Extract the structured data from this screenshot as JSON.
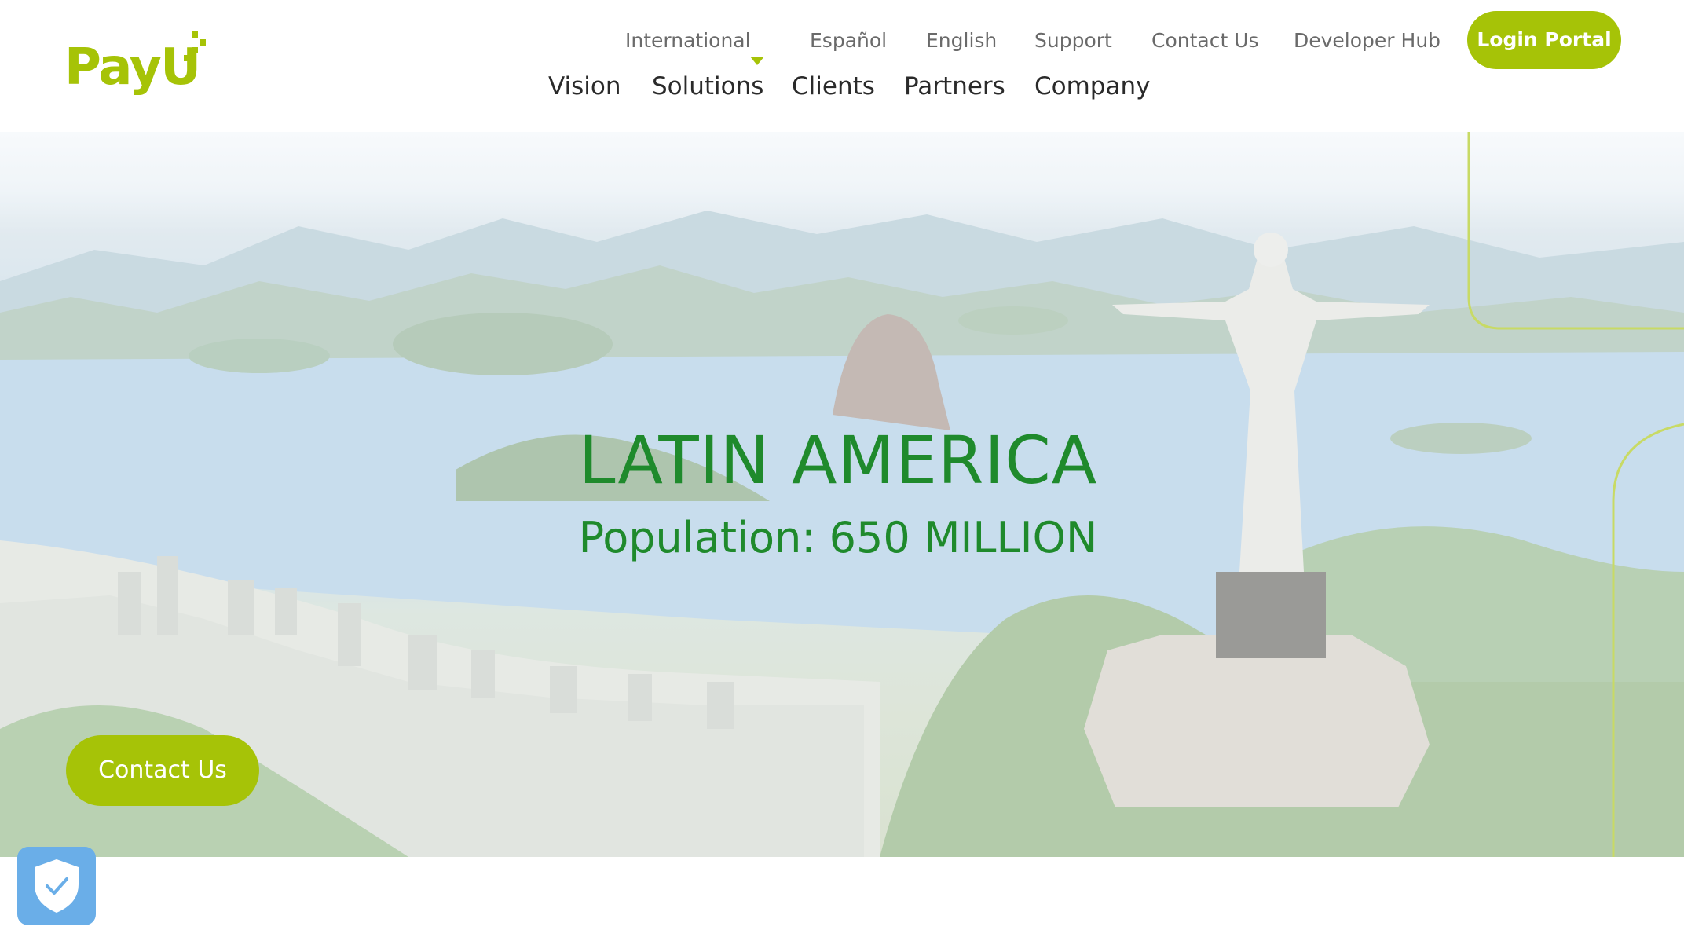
{
  "brand": {
    "logo_text": "PayU",
    "accent_color": "#a6c307",
    "headline_color": "#1f8a2c"
  },
  "utility_nav": {
    "region": "International",
    "region_icon": "caret-down-icon",
    "items": [
      "Español",
      "English",
      "Support",
      "Contact Us",
      "Developer Hub"
    ],
    "login_label": "Login Portal"
  },
  "main_nav": {
    "items": [
      "Vision",
      "Solutions",
      "Clients",
      "Partners",
      "Company"
    ]
  },
  "hero": {
    "background": "aerial view of Rio de Janeiro with Christ the Redeemer statue",
    "title": "LATIN AMERICA",
    "subtitle": "Population: 650 MILLION",
    "cta_label": "Contact Us"
  },
  "privacy_badge": {
    "icon": "shield-check-icon"
  }
}
